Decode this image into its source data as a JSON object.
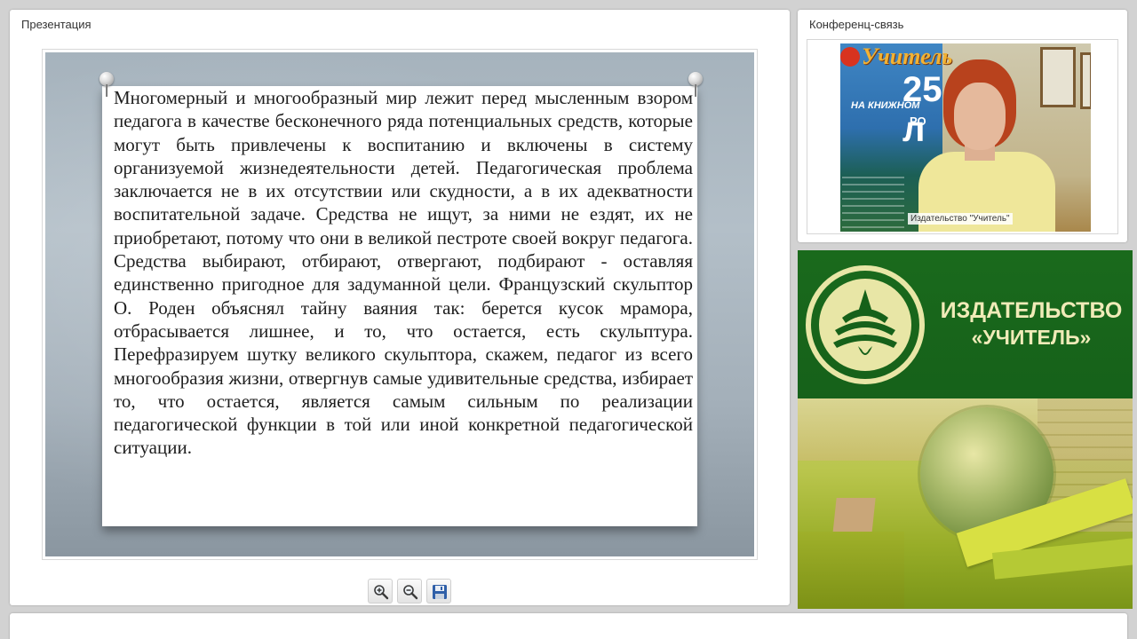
{
  "presentation": {
    "title": "Презентация",
    "slide_text": "Многомерный и многообразный мир лежит перед мысленным взором педагога в качестве бесконечного ряда потенциальных средств, которые могут быть привлечены к воспитанию и включены в систему организуемой жизнедеятельности детей. Педагогическая проблема заключается не в их отсутствии или скудности, а в их адекватности воспитательной задаче. Средства не ищут, за ними не ездят, их не приобретают, потому что они в великой пестроте своей вокруг педагога. Средства выбирают, отбирают, отвергают, подбирают - оставляя единственно пригодное для задуманной цели. Французский скульптор О. Роден объяснял тайну ваяния так: берется кусок мрамора, отбрасывается лишнее, и то, что остается, есть скульптура. Перефразируем шутку великого скульптора, скажем, педагог из всего многообразия жизни, отвергнув самые удивительные средства, избирает то, что остается, является самым сильным по реализации педагогической функции в той или иной конкретной педагогической ситуации.",
    "toolbar": {
      "zoom_in_icon": "zoom-in-icon",
      "zoom_out_icon": "zoom-out-icon",
      "save_icon": "save-icon"
    }
  },
  "conference": {
    "title": "Конференц-связь",
    "video_caption": "Издательство \"Учитель\"",
    "poster_brand": "Учитель",
    "poster_years": "25 л",
    "poster_line1": "НА КНИЖНОМ",
    "poster_line2": "РО"
  },
  "banner": {
    "brand_line1": "ИЗДАТЕЛЬСТВО",
    "brand_line2": "«УЧИТЕЛЬ»"
  },
  "colors": {
    "banner_green": "#16611a",
    "brand_text": "#f0ebb8",
    "page_bg": "#d2d2d2"
  }
}
